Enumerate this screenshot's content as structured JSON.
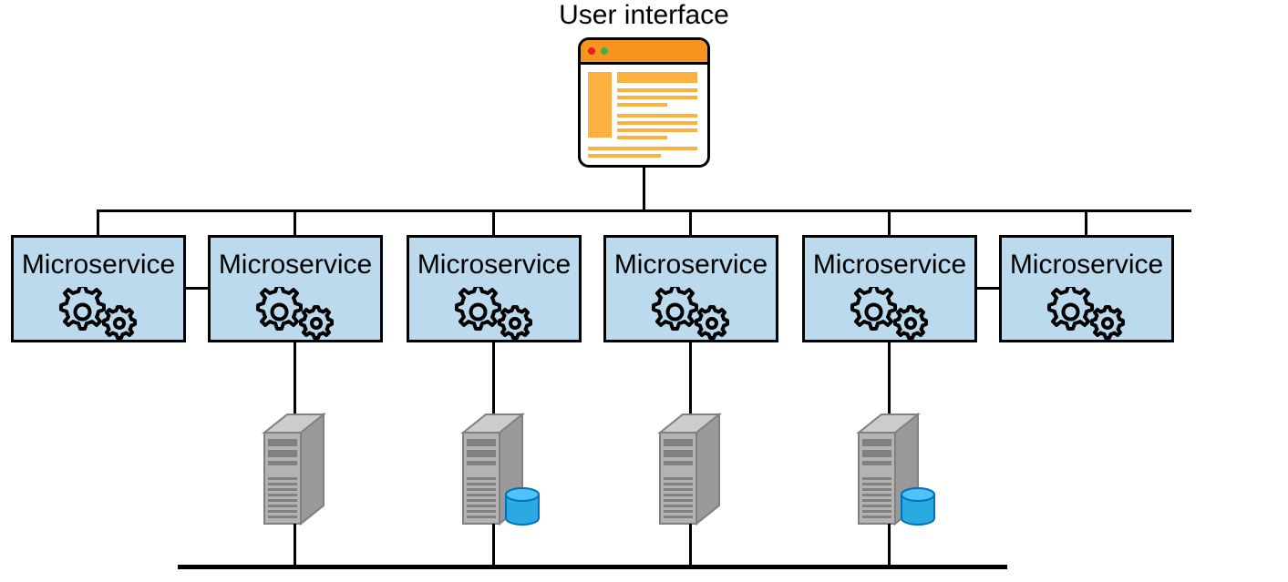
{
  "title": "User interface",
  "microservices": [
    {
      "label": "Microservice"
    },
    {
      "label": "Microservice"
    },
    {
      "label": "Microservice"
    },
    {
      "label": "Microservice"
    },
    {
      "label": "Microservice"
    },
    {
      "label": "Microservice"
    }
  ],
  "layout": {
    "ui_window": {
      "has_titlebar_dots": true
    },
    "servers": [
      {
        "under_microservice_index": 1,
        "has_database": false
      },
      {
        "under_microservice_index": 2,
        "has_database": true
      },
      {
        "under_microservice_index": 3,
        "has_database": false
      },
      {
        "under_microservice_index": 4,
        "has_database": true
      }
    ],
    "pairs_connected_horizontally": [
      [
        0,
        1
      ],
      [
        4,
        5
      ]
    ],
    "bottom_bus_connects_servers": true
  },
  "colors": {
    "microservice_fill": "#BBDAED",
    "ui_titlebar": "#F7941D",
    "ui_content_blocks": "#FBB040",
    "server_body": "#B3B3B3",
    "server_shadow": "#808080",
    "database": "#29ABE2",
    "stroke": "#000000"
  }
}
